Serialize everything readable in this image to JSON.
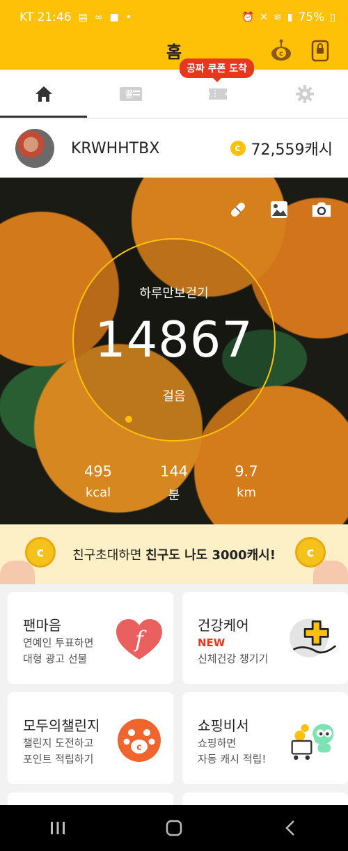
{
  "status_bar": {
    "carrier_time": "KT 21:46",
    "battery": "75%"
  },
  "header": {
    "title": "홈"
  },
  "tabs": {
    "coupon_badge": "공짜 쿠폰 도착"
  },
  "profile": {
    "username": "KRWHHTBX",
    "cash": "72,559캐시"
  },
  "pedometer": {
    "label": "하루만보걷기",
    "steps": "14867",
    "steps_unit": "걸음",
    "kcal_value": "495",
    "kcal_unit": "kcal",
    "minutes_value": "144",
    "minutes_unit": "분",
    "distance_value": "9.7",
    "distance_unit": "km"
  },
  "invite": {
    "text_plain": "친구초대하면 ",
    "text_bold": "친구도 나도 3000캐시!"
  },
  "cards": [
    {
      "title": "팬마음",
      "line1": "연예인 투표하면",
      "line2": "대형 광고 선물"
    },
    {
      "title": "건강케어",
      "line1": "NEW",
      "line2": "신체건강 챙기기"
    },
    {
      "title": "모두의챌린지",
      "line1": "챌린지 도전하고",
      "line2": "포인트 적립하기"
    },
    {
      "title": "쇼핑비서",
      "line1": "쇼핑하면",
      "line2": "자동 캐시 적립!"
    }
  ],
  "colors": {
    "brand_yellow": "#ffc107",
    "badge_red": "#e8371e",
    "banner_bg": "#fdf0c7"
  },
  "icons": {
    "status": [
      "message-icon",
      "link-icon",
      "chat-icon",
      "alarm-icon",
      "mute-icon",
      "wifi-icon",
      "signal-icon",
      "battery-icon"
    ],
    "header": [
      "coin-mascot-icon",
      "lock-icon"
    ],
    "tabs": [
      "home-icon",
      "ticket-icon",
      "coupon-icon",
      "gear-icon"
    ],
    "hero": [
      "pill-icon",
      "image-icon",
      "camera-icon"
    ],
    "nav": [
      "recent-apps-icon",
      "home-nav-icon",
      "back-icon"
    ]
  }
}
